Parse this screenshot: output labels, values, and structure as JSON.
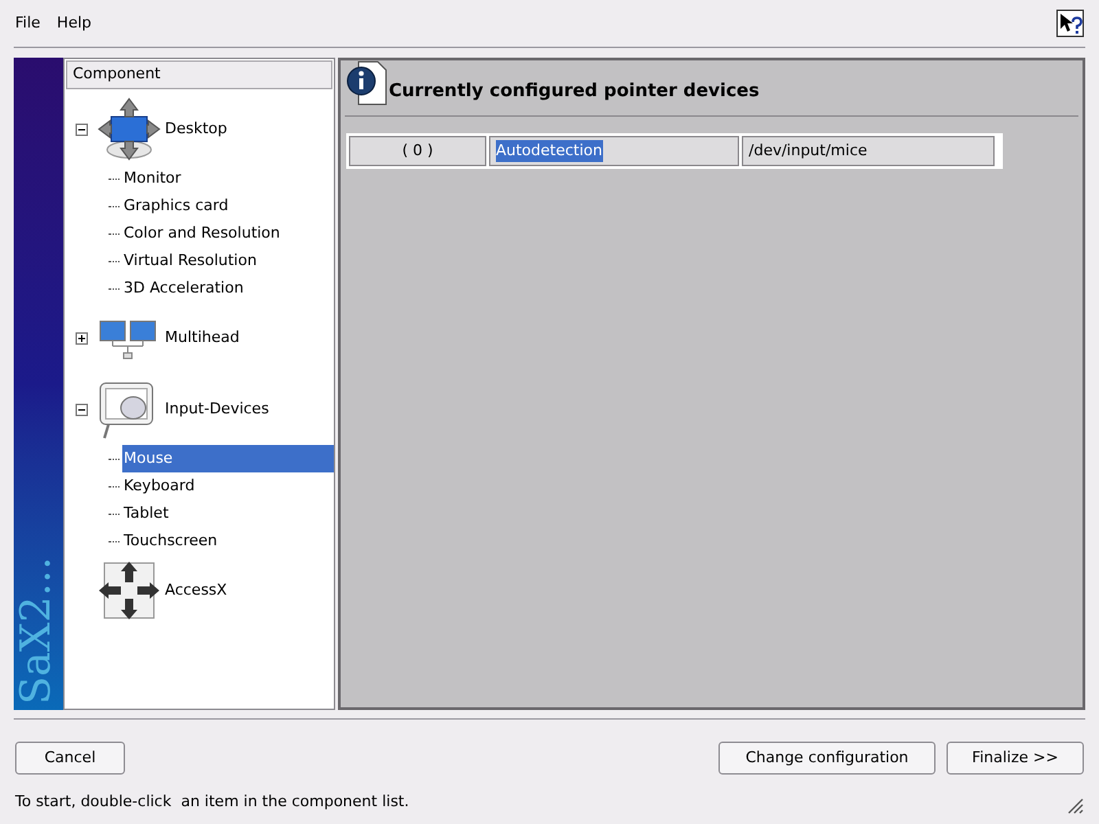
{
  "menu": [
    "File",
    "Help"
  ],
  "banner": "SaX2...",
  "tree": {
    "header": "Component",
    "items": [
      {
        "label": "Desktop",
        "kind": "desktop",
        "expanded": true,
        "selected": false,
        "children": [
          {
            "label": "Monitor",
            "selected": false
          },
          {
            "label": "Graphics card",
            "selected": false
          },
          {
            "label": "Color and Resolution",
            "selected": false
          },
          {
            "label": "Virtual Resolution",
            "selected": false
          },
          {
            "label": "3D Acceleration",
            "selected": false
          }
        ]
      },
      {
        "label": "Multihead",
        "kind": "multihead",
        "expanded": false,
        "selected": false
      },
      {
        "label": "Input-Devices",
        "kind": "input",
        "expanded": true,
        "selected": false,
        "children": [
          {
            "label": "Mouse",
            "selected": true
          },
          {
            "label": "Keyboard",
            "selected": false
          },
          {
            "label": "Tablet",
            "selected": false
          },
          {
            "label": "Touchscreen",
            "selected": false
          }
        ]
      },
      {
        "label": "AccessX",
        "kind": "accessx",
        "selected": false
      }
    ]
  },
  "panel": {
    "title": "Currently configured pointer devices",
    "rows": [
      {
        "cells": [
          "( 0 )",
          "Autodetection",
          "/dev/input/mice"
        ],
        "selected": true
      }
    ]
  },
  "buttons": {
    "left": [
      "Cancel"
    ],
    "right": [
      "Change configuration",
      "Finalize >>"
    ]
  },
  "status_bar": "To start, double-click  an item in the component list."
}
